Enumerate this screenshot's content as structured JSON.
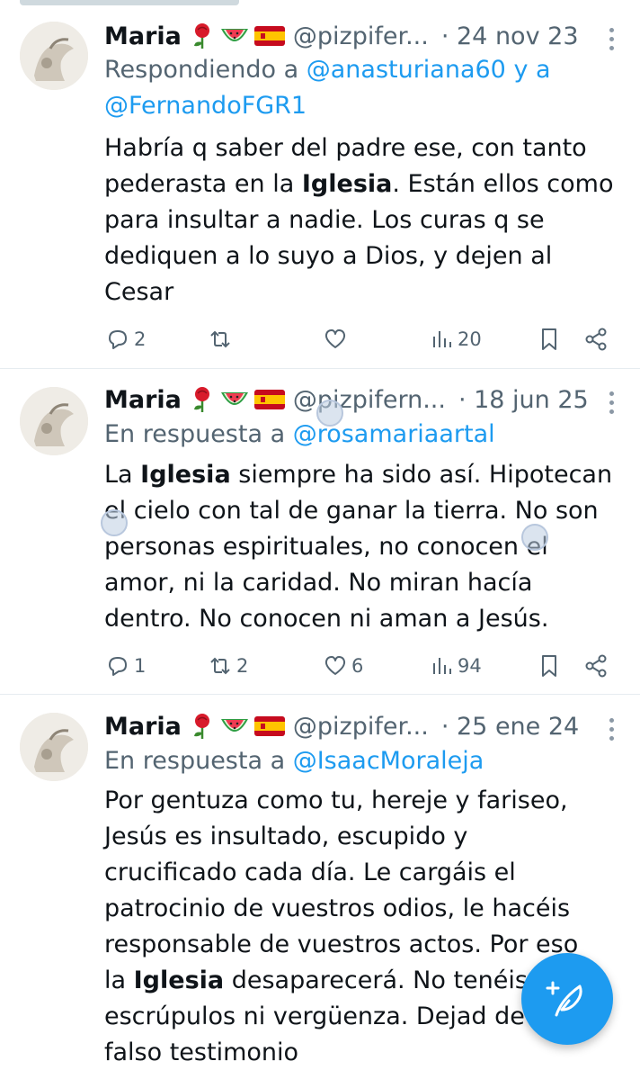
{
  "tweets": [
    {
      "author_name": "Maria",
      "emojis": [
        "rose-emoji",
        "watermelon-emoji",
        "spain-flag-emoji"
      ],
      "handle": "@pizpifer...",
      "date": "· 24 nov 23",
      "reply_prefix": "Respondiendo a ",
      "reply_mention_1": "@anasturiana60",
      "reply_joiner": " y a",
      "reply_mention_2": "@FernandoFGR1",
      "body": {
        "line1": "Habría q saber del padre ese, con tanto",
        "line2_a": "pederasta  en la ",
        "line2_bold": "Iglesia",
        "line2_b": ". Están ellos como",
        "line3": "para insultar a nadie.  Los curas q se",
        "line4": "dediquen a lo suyo a Dios, y dejen al",
        "line5": "Cesar"
      },
      "counts": {
        "replies": "2",
        "retweets": "",
        "likes": "",
        "views": "20"
      }
    },
    {
      "author_name": "Maria",
      "emojis": [
        "rose-emoji",
        "watermelon-emoji",
        "spain-flag-emoji"
      ],
      "handle": "@pizpifern...",
      "date": "· 18 jun 25",
      "reply_prefix": "En respuesta a ",
      "reply_mention_1": "@rosamariaartal",
      "body": {
        "line1_a": "La ",
        "line1_bold": "Iglesia",
        "line1_b": " siempre ha sido así. Hipotecan",
        "line2": "el cielo con tal de ganar la tierra. No son",
        "line3": "personas espirituales, no conocen el",
        "line4": "amor, ni la caridad. No miran hacía",
        "line5": "dentro. No conocen ni aman a Jesús."
      },
      "counts": {
        "replies": "1",
        "retweets": "2",
        "likes": "6",
        "views": "94"
      }
    },
    {
      "author_name": "Maria",
      "emojis": [
        "rose-emoji",
        "watermelon-emoji",
        "spain-flag-emoji"
      ],
      "handle": "@pizpifer...",
      "date": "· 25 ene 24",
      "reply_prefix": "En respuesta a ",
      "reply_mention_1": "@IsaacMoraleja",
      "body": {
        "line1": "Por gentuza como tu, hereje y fariseo,",
        "line2": "Jesús es insultado, escupido y",
        "line3": "crucificado cada día. Le cargáis el",
        "line4": "patrocinio de vuestros odios, le hacéis",
        "line5": "responsable de vuestros actos. Por eso",
        "line6_a": "la ",
        "line6_bold": "Iglesia",
        "line6_b": " desaparecerá. No tenéis",
        "line7": "escrúpulos ni vergüenza. Dejad de",
        "line8": "falso testimonio"
      }
    }
  ],
  "compose_button": {
    "icon": "compose-feather-icon",
    "color": "#1d9bf0"
  },
  "colors": {
    "accent": "#1d9bf0",
    "muted": "#536471",
    "text": "#0f1419",
    "divider": "#e6ecf0"
  }
}
